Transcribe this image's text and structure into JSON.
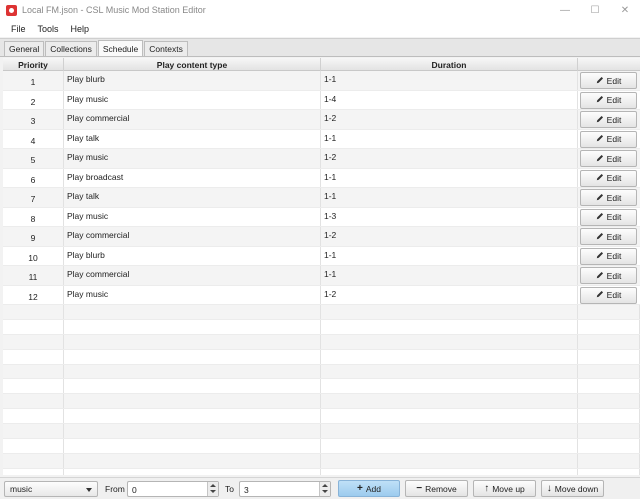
{
  "window": {
    "title": "Local FM.json - CSL Music Mod Station Editor",
    "minimize_glyph": "—",
    "maximize_glyph": "☐",
    "close_glyph": "✕"
  },
  "menu": [
    "File",
    "Tools",
    "Help"
  ],
  "tabs": [
    {
      "label": "General",
      "active": false
    },
    {
      "label": "Collections",
      "active": false
    },
    {
      "label": "Schedule",
      "active": true
    },
    {
      "label": "Contexts",
      "active": false
    }
  ],
  "table": {
    "headers": [
      "Priority",
      "Play content type",
      "Duration",
      ""
    ],
    "edit_label": "Edit",
    "rows": [
      {
        "priority": "1",
        "content": "Play blurb",
        "duration": "1-1"
      },
      {
        "priority": "2",
        "content": "Play music",
        "duration": "1-4"
      },
      {
        "priority": "3",
        "content": "Play commercial",
        "duration": "1-2"
      },
      {
        "priority": "4",
        "content": "Play talk",
        "duration": "1-1"
      },
      {
        "priority": "5",
        "content": "Play music",
        "duration": "1-2"
      },
      {
        "priority": "6",
        "content": "Play broadcast",
        "duration": "1-1"
      },
      {
        "priority": "7",
        "content": "Play talk",
        "duration": "1-1"
      },
      {
        "priority": "8",
        "content": "Play music",
        "duration": "1-3"
      },
      {
        "priority": "9",
        "content": "Play commercial",
        "duration": "1-2"
      },
      {
        "priority": "10",
        "content": "Play blurb",
        "duration": "1-1"
      },
      {
        "priority": "11",
        "content": "Play commercial",
        "duration": "1-1"
      },
      {
        "priority": "12",
        "content": "Play music",
        "duration": "1-2"
      }
    ]
  },
  "bottom": {
    "type_select": "music",
    "from_label": "From",
    "from_value": "0",
    "to_label": "To",
    "to_value": "3",
    "add_label": "Add",
    "remove_label": "Remove",
    "move_up_label": "Move up",
    "move_down_label": "Move down"
  },
  "colors": {
    "primary_button": "#a8d2f2",
    "header_bg": "#e8e8e8"
  }
}
